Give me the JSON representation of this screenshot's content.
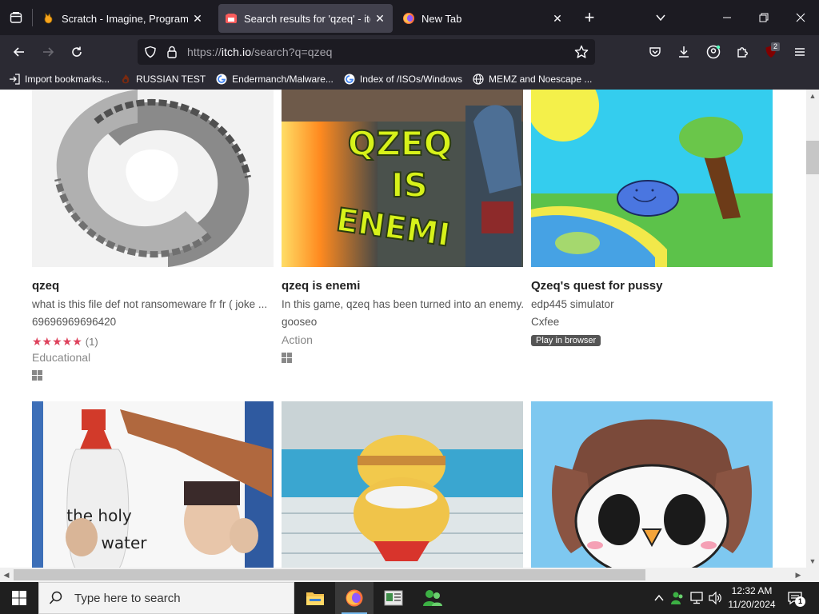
{
  "browser": {
    "tabs": [
      {
        "title": "Scratch - Imagine, Program, Sh",
        "favicon": "scratch-cat-icon",
        "active": false
      },
      {
        "title": "Search results for 'qzeq' - itch.io",
        "favicon": "itchio-icon",
        "active": true
      },
      {
        "title": "New Tab",
        "favicon": "firefox-icon",
        "active": false
      }
    ],
    "url": {
      "prefix": "https://",
      "host": "itch.io",
      "path": "/search?q=qzeq"
    },
    "badge_count": "2",
    "bookmarks": [
      {
        "label": "Import bookmarks...",
        "icon": "import-icon"
      },
      {
        "label": "RUSSIAN TEST",
        "icon": "flame-icon"
      },
      {
        "label": "Endermanch/Malware...",
        "icon": "google-icon"
      },
      {
        "label": "Index of /ISOs/Windows",
        "icon": "google-icon"
      },
      {
        "label": "MEMZ and Noescape ...",
        "icon": "globe-icon"
      }
    ]
  },
  "results": [
    {
      "title": "qzeq",
      "description": "what is this file def not ransomeware fr fr ( joke ...",
      "author": "69696969696420",
      "rating_stars": "★★★★★",
      "rating_count": "(1)",
      "genre": "Educational",
      "platform": "windows-icon"
    },
    {
      "title": "qzeq is enemi",
      "description": "In this game, qzeq has been turned into an enemy.",
      "author": "gooseo",
      "genre": "Action",
      "platform": "windows-icon",
      "thumb_text": [
        "QZEQ",
        "IS",
        "ENEMI"
      ]
    },
    {
      "title": "Qzeq's quest for pussy",
      "description": "edp445 simulator",
      "author": "Cxfee",
      "web_flag": "Play in browser"
    },
    {
      "thumb_text": [
        "the holy",
        "water"
      ]
    },
    {},
    {}
  ],
  "taskbar": {
    "search_placeholder": "Type here to search",
    "time": "12:32 AM",
    "date": "11/20/2024",
    "notification_count": "1",
    "apps": [
      "file-explorer-icon",
      "firefox-icon",
      "news-app-icon",
      "people-app-icon"
    ]
  }
}
